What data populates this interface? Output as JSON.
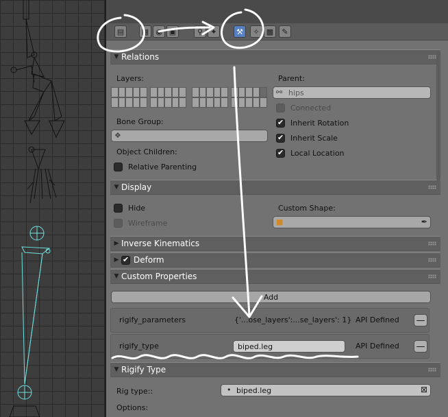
{
  "toolbar": {
    "buttons": [
      {
        "icon": "render-icon"
      },
      {
        "icon": "scene-icon"
      },
      {
        "icon": "world-icon"
      },
      {
        "icon": "object-icon"
      },
      {
        "icon": "constraint-icon"
      },
      {
        "icon": "modifier-icon"
      },
      {
        "icon": "bone-icon",
        "active": true
      },
      {
        "icon": "bone-constraint-icon"
      },
      {
        "icon": "material-icon"
      },
      {
        "icon": "texture-icon"
      }
    ]
  },
  "relations": {
    "title": "Relations",
    "layers_label": "Layers:",
    "parent_label": "Parent:",
    "parent_value": "hips",
    "connected_label": "Connected",
    "inherit_rotation_label": "Inherit Rotation",
    "inherit_scale_label": "Inherit Scale",
    "local_location_label": "Local Location",
    "bone_group_label": "Bone Group:",
    "bone_group_value": "",
    "object_children_label": "Object Children:",
    "relative_parenting_label": "Relative Parenting",
    "inherit_rotation": true,
    "inherit_scale": true,
    "local_location": true,
    "connected": false,
    "relative_parenting": false
  },
  "display": {
    "title": "Display",
    "hide_label": "Hide",
    "wireframe_label": "Wireframe",
    "custom_shape_label": "Custom Shape:",
    "custom_shape_value": ""
  },
  "inverse_kinematics": {
    "title": "Inverse Kinematics"
  },
  "deform": {
    "title": "Deform",
    "enabled": true
  },
  "custom_properties": {
    "title": "Custom Properties",
    "add_label": "Add",
    "properties": [
      {
        "name": "rigify_parameters",
        "value": "{'...ose_layers':...se_layers': 1}",
        "api": "API Defined"
      },
      {
        "name": "rigify_type",
        "value": "biped.leg",
        "api": "API Defined"
      }
    ]
  },
  "rigify_type": {
    "title": "Rigify Type",
    "rig_type_label": "Rig type::",
    "rig_type_value": "biped.leg",
    "options_label": "Options:"
  },
  "annotation_colors": {
    "stroke": "#ffffff",
    "accent": "#5680c2",
    "bone": "#6fe0e0"
  }
}
